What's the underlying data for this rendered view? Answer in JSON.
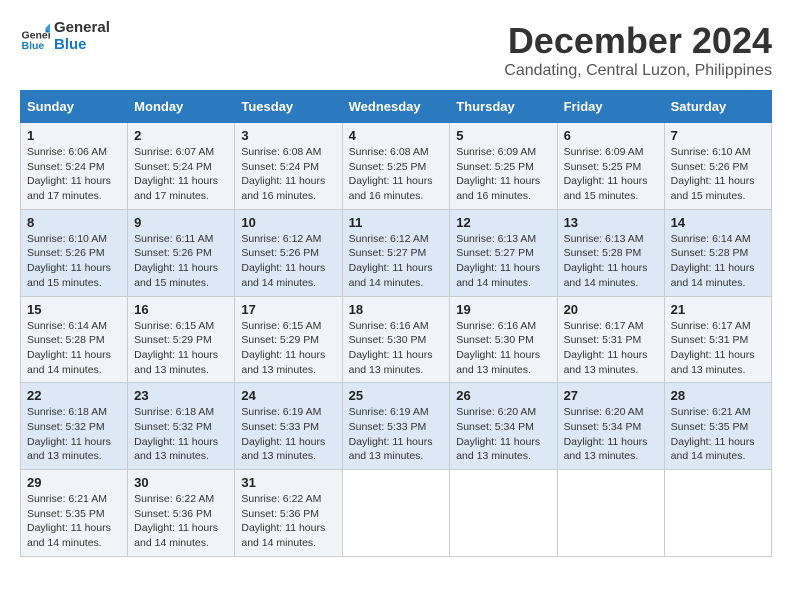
{
  "logo": {
    "line1": "General",
    "line2": "Blue"
  },
  "title": "December 2024",
  "subtitle": "Candating, Central Luzon, Philippines",
  "days_of_week": [
    "Sunday",
    "Monday",
    "Tuesday",
    "Wednesday",
    "Thursday",
    "Friday",
    "Saturday"
  ],
  "weeks": [
    [
      {
        "num": "1",
        "info": "Sunrise: 6:06 AM\nSunset: 5:24 PM\nDaylight: 11 hours and 17 minutes."
      },
      {
        "num": "2",
        "info": "Sunrise: 6:07 AM\nSunset: 5:24 PM\nDaylight: 11 hours and 17 minutes."
      },
      {
        "num": "3",
        "info": "Sunrise: 6:08 AM\nSunset: 5:24 PM\nDaylight: 11 hours and 16 minutes."
      },
      {
        "num": "4",
        "info": "Sunrise: 6:08 AM\nSunset: 5:25 PM\nDaylight: 11 hours and 16 minutes."
      },
      {
        "num": "5",
        "info": "Sunrise: 6:09 AM\nSunset: 5:25 PM\nDaylight: 11 hours and 16 minutes."
      },
      {
        "num": "6",
        "info": "Sunrise: 6:09 AM\nSunset: 5:25 PM\nDaylight: 11 hours and 15 minutes."
      },
      {
        "num": "7",
        "info": "Sunrise: 6:10 AM\nSunset: 5:26 PM\nDaylight: 11 hours and 15 minutes."
      }
    ],
    [
      {
        "num": "8",
        "info": "Sunrise: 6:10 AM\nSunset: 5:26 PM\nDaylight: 11 hours and 15 minutes."
      },
      {
        "num": "9",
        "info": "Sunrise: 6:11 AM\nSunset: 5:26 PM\nDaylight: 11 hours and 15 minutes."
      },
      {
        "num": "10",
        "info": "Sunrise: 6:12 AM\nSunset: 5:26 PM\nDaylight: 11 hours and 14 minutes."
      },
      {
        "num": "11",
        "info": "Sunrise: 6:12 AM\nSunset: 5:27 PM\nDaylight: 11 hours and 14 minutes."
      },
      {
        "num": "12",
        "info": "Sunrise: 6:13 AM\nSunset: 5:27 PM\nDaylight: 11 hours and 14 minutes."
      },
      {
        "num": "13",
        "info": "Sunrise: 6:13 AM\nSunset: 5:28 PM\nDaylight: 11 hours and 14 minutes."
      },
      {
        "num": "14",
        "info": "Sunrise: 6:14 AM\nSunset: 5:28 PM\nDaylight: 11 hours and 14 minutes."
      }
    ],
    [
      {
        "num": "15",
        "info": "Sunrise: 6:14 AM\nSunset: 5:28 PM\nDaylight: 11 hours and 14 minutes."
      },
      {
        "num": "16",
        "info": "Sunrise: 6:15 AM\nSunset: 5:29 PM\nDaylight: 11 hours and 13 minutes."
      },
      {
        "num": "17",
        "info": "Sunrise: 6:15 AM\nSunset: 5:29 PM\nDaylight: 11 hours and 13 minutes."
      },
      {
        "num": "18",
        "info": "Sunrise: 6:16 AM\nSunset: 5:30 PM\nDaylight: 11 hours and 13 minutes."
      },
      {
        "num": "19",
        "info": "Sunrise: 6:16 AM\nSunset: 5:30 PM\nDaylight: 11 hours and 13 minutes."
      },
      {
        "num": "20",
        "info": "Sunrise: 6:17 AM\nSunset: 5:31 PM\nDaylight: 11 hours and 13 minutes."
      },
      {
        "num": "21",
        "info": "Sunrise: 6:17 AM\nSunset: 5:31 PM\nDaylight: 11 hours and 13 minutes."
      }
    ],
    [
      {
        "num": "22",
        "info": "Sunrise: 6:18 AM\nSunset: 5:32 PM\nDaylight: 11 hours and 13 minutes."
      },
      {
        "num": "23",
        "info": "Sunrise: 6:18 AM\nSunset: 5:32 PM\nDaylight: 11 hours and 13 minutes."
      },
      {
        "num": "24",
        "info": "Sunrise: 6:19 AM\nSunset: 5:33 PM\nDaylight: 11 hours and 13 minutes."
      },
      {
        "num": "25",
        "info": "Sunrise: 6:19 AM\nSunset: 5:33 PM\nDaylight: 11 hours and 13 minutes."
      },
      {
        "num": "26",
        "info": "Sunrise: 6:20 AM\nSunset: 5:34 PM\nDaylight: 11 hours and 13 minutes."
      },
      {
        "num": "27",
        "info": "Sunrise: 6:20 AM\nSunset: 5:34 PM\nDaylight: 11 hours and 13 minutes."
      },
      {
        "num": "28",
        "info": "Sunrise: 6:21 AM\nSunset: 5:35 PM\nDaylight: 11 hours and 14 minutes."
      }
    ],
    [
      {
        "num": "29",
        "info": "Sunrise: 6:21 AM\nSunset: 5:35 PM\nDaylight: 11 hours and 14 minutes."
      },
      {
        "num": "30",
        "info": "Sunrise: 6:22 AM\nSunset: 5:36 PM\nDaylight: 11 hours and 14 minutes."
      },
      {
        "num": "31",
        "info": "Sunrise: 6:22 AM\nSunset: 5:36 PM\nDaylight: 11 hours and 14 minutes."
      },
      null,
      null,
      null,
      null
    ]
  ]
}
